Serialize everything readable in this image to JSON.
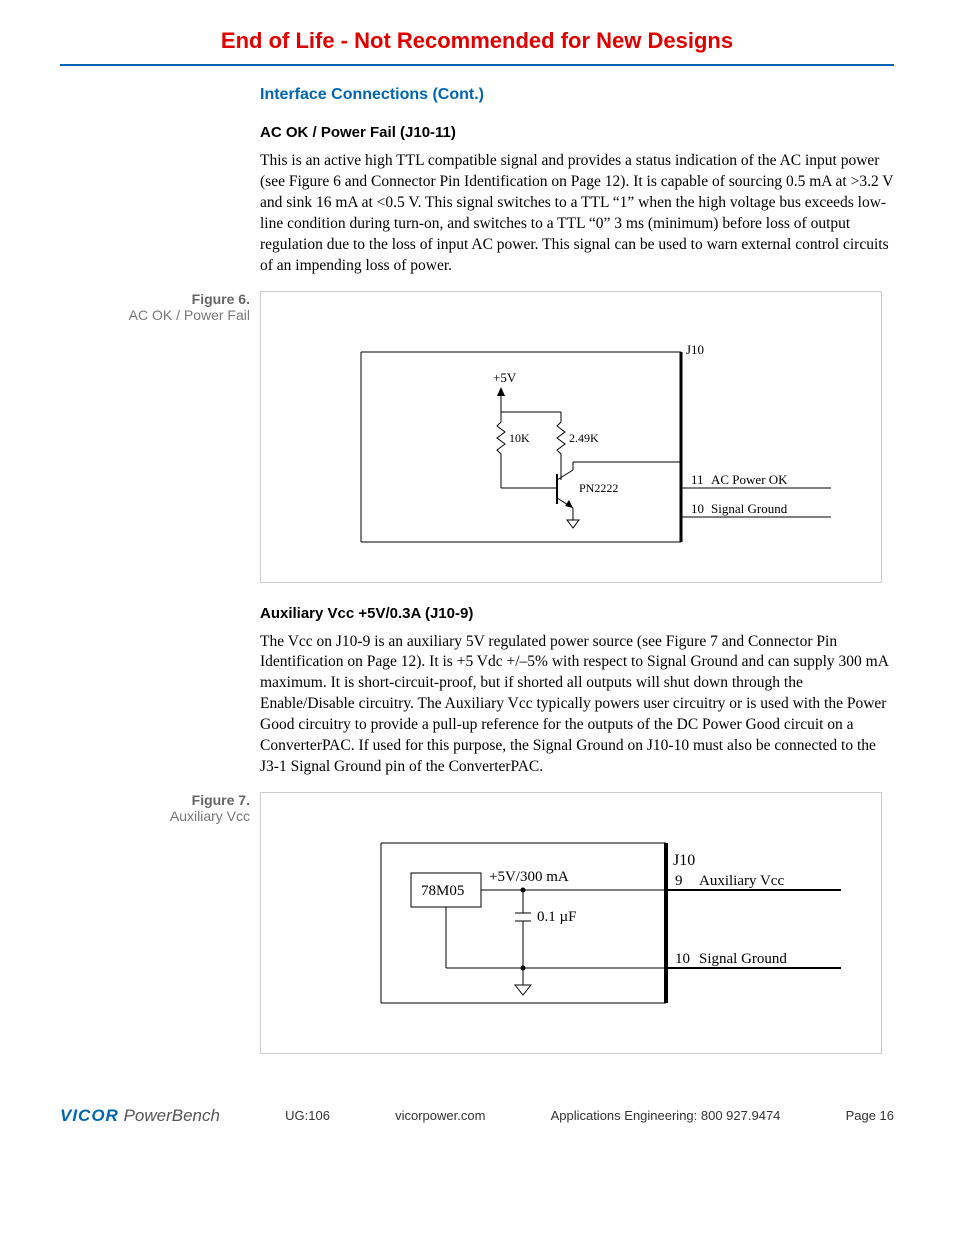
{
  "banner": "End of Life - Not Recommended for New Designs",
  "section_title": "Interface Connections (Cont.)",
  "sec1": {
    "heading": "AC OK / Power Fail (J10-11)",
    "body": "This is an active high TTL compatible signal and provides a status indication of the AC input power (see Figure 6 and Connector Pin Identification on Page 12). It is capable of sourcing 0.5 mA at >3.2 V and sink 16 mA at <0.5 V. This signal switches to a TTL “1” when the high voltage bus exceeds low-line condition during turn-on, and switches to a TTL “0” 3 ms (minimum) before loss of output regulation due to the loss of input AC power. This signal can be used to warn external control circuits of an impending loss of power."
  },
  "fig6": {
    "label": "Figure 6.",
    "caption": "AC OK / Power Fail",
    "labels": {
      "j10": "J10",
      "p5v": "+5V",
      "r1": "10K",
      "r2": "2.49K",
      "q": "PN2222",
      "pin11": "11",
      "pin11name": "AC Power OK",
      "pin10": "10",
      "pin10name": "Signal Ground"
    }
  },
  "sec2": {
    "heading": "Auxiliary Vcc +5V/0.3A (J10-9)",
    "body": "The Vcc on J10-9 is an auxiliary 5V regulated power source (see Figure 7 and Connector Pin Identification on Page 12). It is +5 Vdc +/–5% with respect to Signal Ground and can supply 300 mA maximum. It is short-circuit-proof, but if shorted all outputs will shut down through the Enable/Disable circuitry. The Auxiliary Vcc typically powers user circuitry or is used with the Power Good circuitry to provide a pull-up reference for the outputs of the DC Power Good circuit on a ConverterPAC. If used for this purpose, the Signal Ground on J10-10 must also be connected to the J3-1 Signal Ground pin of the ConverterPAC."
  },
  "fig7": {
    "label": "Figure 7.",
    "caption": "Auxiliary Vcc",
    "labels": {
      "reg": "78M05",
      "out": "+5V/300 mA",
      "cap": "0.1 µF",
      "j10": "J10",
      "pin9": "9",
      "pin9name": "Auxiliary Vcc",
      "pin10": "10",
      "pin10name": "Signal Ground"
    }
  },
  "footer": {
    "logo1": "VICOR",
    "logo2": "PowerBench",
    "ug": "UG:106",
    "site": "vicorpower.com",
    "phone": "Applications Engineering: 800 927.9474",
    "page": "Page 16"
  }
}
